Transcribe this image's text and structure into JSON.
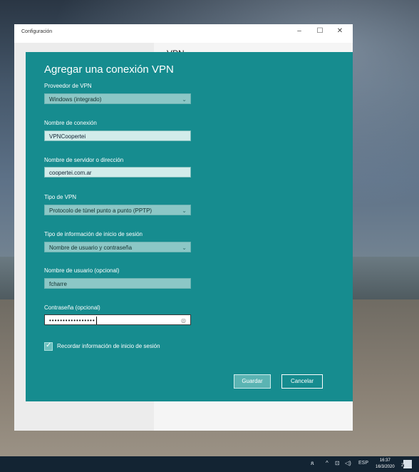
{
  "window": {
    "title": "Configuración",
    "minimize": "–",
    "maximize": "☐",
    "close": "✕",
    "page_heading": "VPN"
  },
  "dialog": {
    "title": "Agregar una conexión VPN",
    "provider": {
      "label": "Proveedor de VPN",
      "value": "Windows (integrado)"
    },
    "connection_name": {
      "label": "Nombre de conexión",
      "value": "VPNCoopertei"
    },
    "server": {
      "label": "Nombre de servidor o dirección",
      "value": "coopertei.com.ar"
    },
    "vpn_type": {
      "label": "Tipo de VPN",
      "value": "Protocolo de túnel punto a punto (PPTP)"
    },
    "signin_type": {
      "label": "Tipo de información de inicio de sesión",
      "value": "Nombre de usuario y contraseña"
    },
    "username": {
      "label": "Nombre de usuario (opcional)",
      "value": "fcharre"
    },
    "password": {
      "label": "Contraseña (opcional)",
      "value": "•••••••••••••••••"
    },
    "remember": {
      "label": "Recordar información de inicio de sesión",
      "checked": true
    },
    "save_label": "Guardar",
    "cancel_label": "Cancelar"
  },
  "taskbar": {
    "language": "ESP",
    "time": "16:37",
    "date": "16/3/2020",
    "notification_count": "2"
  },
  "colors": {
    "dialog_bg": "#168c8f",
    "taskbar_bg": "#132433"
  },
  "icons": [
    "people-icon",
    "chevron-up-icon",
    "network-icon",
    "volume-icon",
    "notification-icon",
    "eye-icon",
    "checkmark-icon",
    "chevron-down-icon"
  ]
}
